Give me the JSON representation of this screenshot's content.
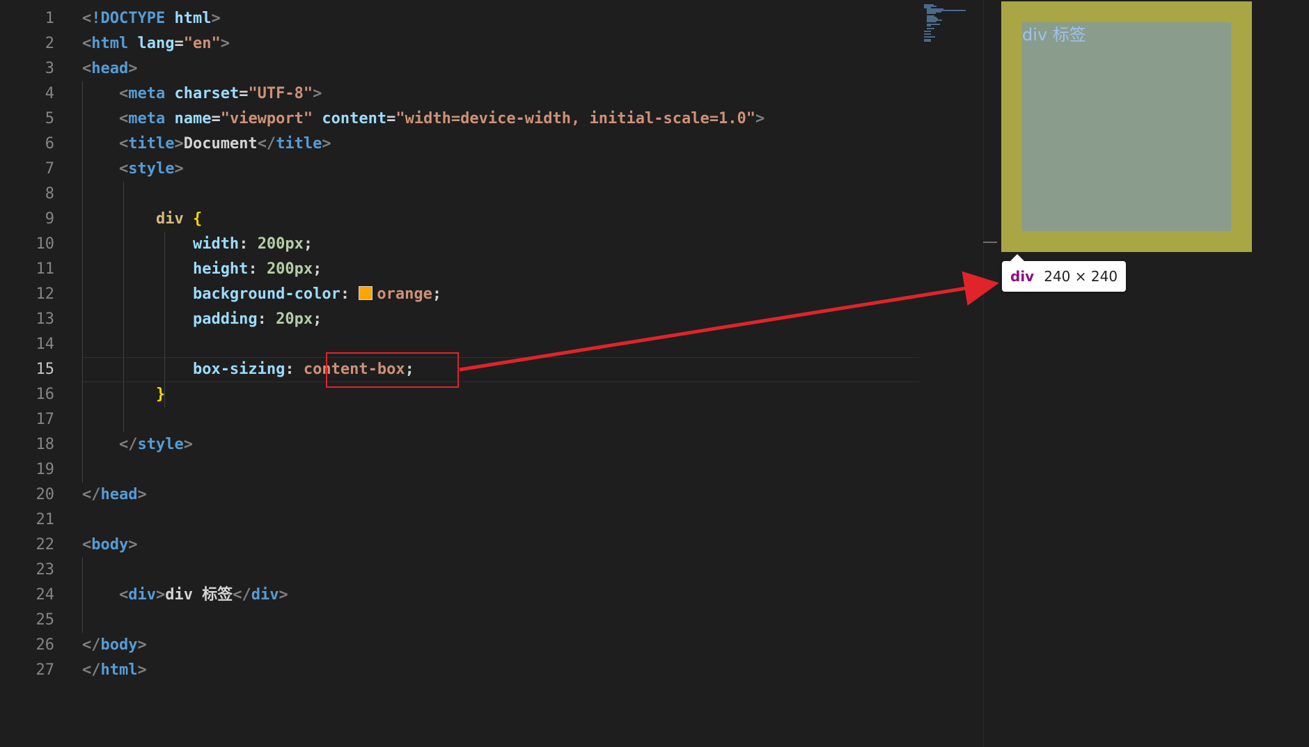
{
  "editor": {
    "lines": [
      {
        "n": "1",
        "tokens": [
          [
            "punct",
            "<"
          ],
          [
            "tag",
            "!DOCTYPE"
          ],
          [
            "txt",
            " "
          ],
          [
            "attr",
            "html"
          ],
          [
            "punct",
            ">"
          ]
        ]
      },
      {
        "n": "2",
        "tokens": [
          [
            "punct",
            "<"
          ],
          [
            "tag",
            "html"
          ],
          [
            "txt",
            " "
          ],
          [
            "attr",
            "lang"
          ],
          [
            "txt",
            "="
          ],
          [
            "str",
            "\"en\""
          ],
          [
            "punct",
            ">"
          ]
        ]
      },
      {
        "n": "3",
        "tokens": [
          [
            "punct",
            "<"
          ],
          [
            "tag",
            "head"
          ],
          [
            "punct",
            ">"
          ]
        ]
      },
      {
        "n": "4",
        "tokens": [
          [
            "txt",
            "    "
          ],
          [
            "punct",
            "<"
          ],
          [
            "tag",
            "meta"
          ],
          [
            "txt",
            " "
          ],
          [
            "attr",
            "charset"
          ],
          [
            "txt",
            "="
          ],
          [
            "str",
            "\"UTF-8\""
          ],
          [
            "punct",
            ">"
          ]
        ]
      },
      {
        "n": "5",
        "tokens": [
          [
            "txt",
            "    "
          ],
          [
            "punct",
            "<"
          ],
          [
            "tag",
            "meta"
          ],
          [
            "txt",
            " "
          ],
          [
            "attr",
            "name"
          ],
          [
            "txt",
            "="
          ],
          [
            "str",
            "\"viewport\""
          ],
          [
            "txt",
            " "
          ],
          [
            "attr",
            "content"
          ],
          [
            "txt",
            "="
          ],
          [
            "str",
            "\"width=device-width, initial-scale=1.0\""
          ],
          [
            "punct",
            ">"
          ]
        ]
      },
      {
        "n": "6",
        "tokens": [
          [
            "txt",
            "    "
          ],
          [
            "punct",
            "<"
          ],
          [
            "tag",
            "title"
          ],
          [
            "punct",
            ">"
          ],
          [
            "txt",
            "Document"
          ],
          [
            "punct",
            "</"
          ],
          [
            "tag",
            "title"
          ],
          [
            "punct",
            ">"
          ]
        ]
      },
      {
        "n": "7",
        "tokens": [
          [
            "txt",
            "    "
          ],
          [
            "punct",
            "<"
          ],
          [
            "tag",
            "style"
          ],
          [
            "punct",
            ">"
          ]
        ]
      },
      {
        "n": "8",
        "tokens": []
      },
      {
        "n": "9",
        "tokens": [
          [
            "txt",
            "        "
          ],
          [
            "sel",
            "div"
          ],
          [
            "txt",
            " "
          ],
          [
            "brace",
            "{"
          ]
        ]
      },
      {
        "n": "10",
        "tokens": [
          [
            "txt",
            "            "
          ],
          [
            "prop",
            "width"
          ],
          [
            "txt",
            ": "
          ],
          [
            "num",
            "200px"
          ],
          [
            "txt",
            ";"
          ]
        ]
      },
      {
        "n": "11",
        "tokens": [
          [
            "txt",
            "            "
          ],
          [
            "prop",
            "height"
          ],
          [
            "txt",
            ": "
          ],
          [
            "num",
            "200px"
          ],
          [
            "txt",
            ";"
          ]
        ]
      },
      {
        "n": "12",
        "tokens": [
          [
            "txt",
            "            "
          ],
          [
            "prop",
            "background-color"
          ],
          [
            "txt",
            ": "
          ],
          [
            "swatch",
            ""
          ],
          [
            "val",
            "orange"
          ],
          [
            "txt",
            ";"
          ]
        ]
      },
      {
        "n": "13",
        "tokens": [
          [
            "txt",
            "            "
          ],
          [
            "prop",
            "padding"
          ],
          [
            "txt",
            ": "
          ],
          [
            "num",
            "20px"
          ],
          [
            "txt",
            ";"
          ]
        ]
      },
      {
        "n": "14",
        "tokens": []
      },
      {
        "n": "15",
        "tokens": [
          [
            "txt",
            "            "
          ],
          [
            "prop",
            "box-sizing"
          ],
          [
            "txt",
            ": "
          ],
          [
            "val",
            "content-box"
          ],
          [
            "txt",
            ";"
          ]
        ]
      },
      {
        "n": "16",
        "tokens": [
          [
            "txt",
            "        "
          ],
          [
            "brace",
            "}"
          ]
        ]
      },
      {
        "n": "17",
        "tokens": []
      },
      {
        "n": "18",
        "tokens": [
          [
            "txt",
            "    "
          ],
          [
            "punct",
            "</"
          ],
          [
            "tag",
            "style"
          ],
          [
            "punct",
            ">"
          ]
        ]
      },
      {
        "n": "19",
        "tokens": []
      },
      {
        "n": "20",
        "tokens": [
          [
            "punct",
            "</"
          ],
          [
            "tag",
            "head"
          ],
          [
            "punct",
            ">"
          ]
        ]
      },
      {
        "n": "21",
        "tokens": []
      },
      {
        "n": "22",
        "tokens": [
          [
            "punct",
            "<"
          ],
          [
            "tag",
            "body"
          ],
          [
            "punct",
            ">"
          ]
        ]
      },
      {
        "n": "23",
        "tokens": []
      },
      {
        "n": "24",
        "tokens": [
          [
            "txt",
            "    "
          ],
          [
            "punct",
            "<"
          ],
          [
            "tag",
            "div"
          ],
          [
            "punct",
            ">"
          ],
          [
            "txt",
            "div 标签"
          ],
          [
            "punct",
            "</"
          ],
          [
            "tag",
            "div"
          ],
          [
            "punct",
            ">"
          ]
        ]
      },
      {
        "n": "25",
        "tokens": []
      },
      {
        "n": "26",
        "tokens": [
          [
            "punct",
            "</"
          ],
          [
            "tag",
            "body"
          ],
          [
            "punct",
            ">"
          ]
        ]
      },
      {
        "n": "27",
        "tokens": [
          [
            "punct",
            "</"
          ],
          [
            "tag",
            "html"
          ],
          [
            "punct",
            ">"
          ]
        ]
      }
    ],
    "active_line": "15",
    "swatch_color": "#ffa500"
  },
  "preview": {
    "div_text": "div 标签",
    "content_color": "#8a9c8b",
    "padding_color": "#a9a645",
    "tooltip_tag": "div",
    "tooltip_size": "240 × 240"
  },
  "annotation": {
    "color": "#e0242a"
  }
}
